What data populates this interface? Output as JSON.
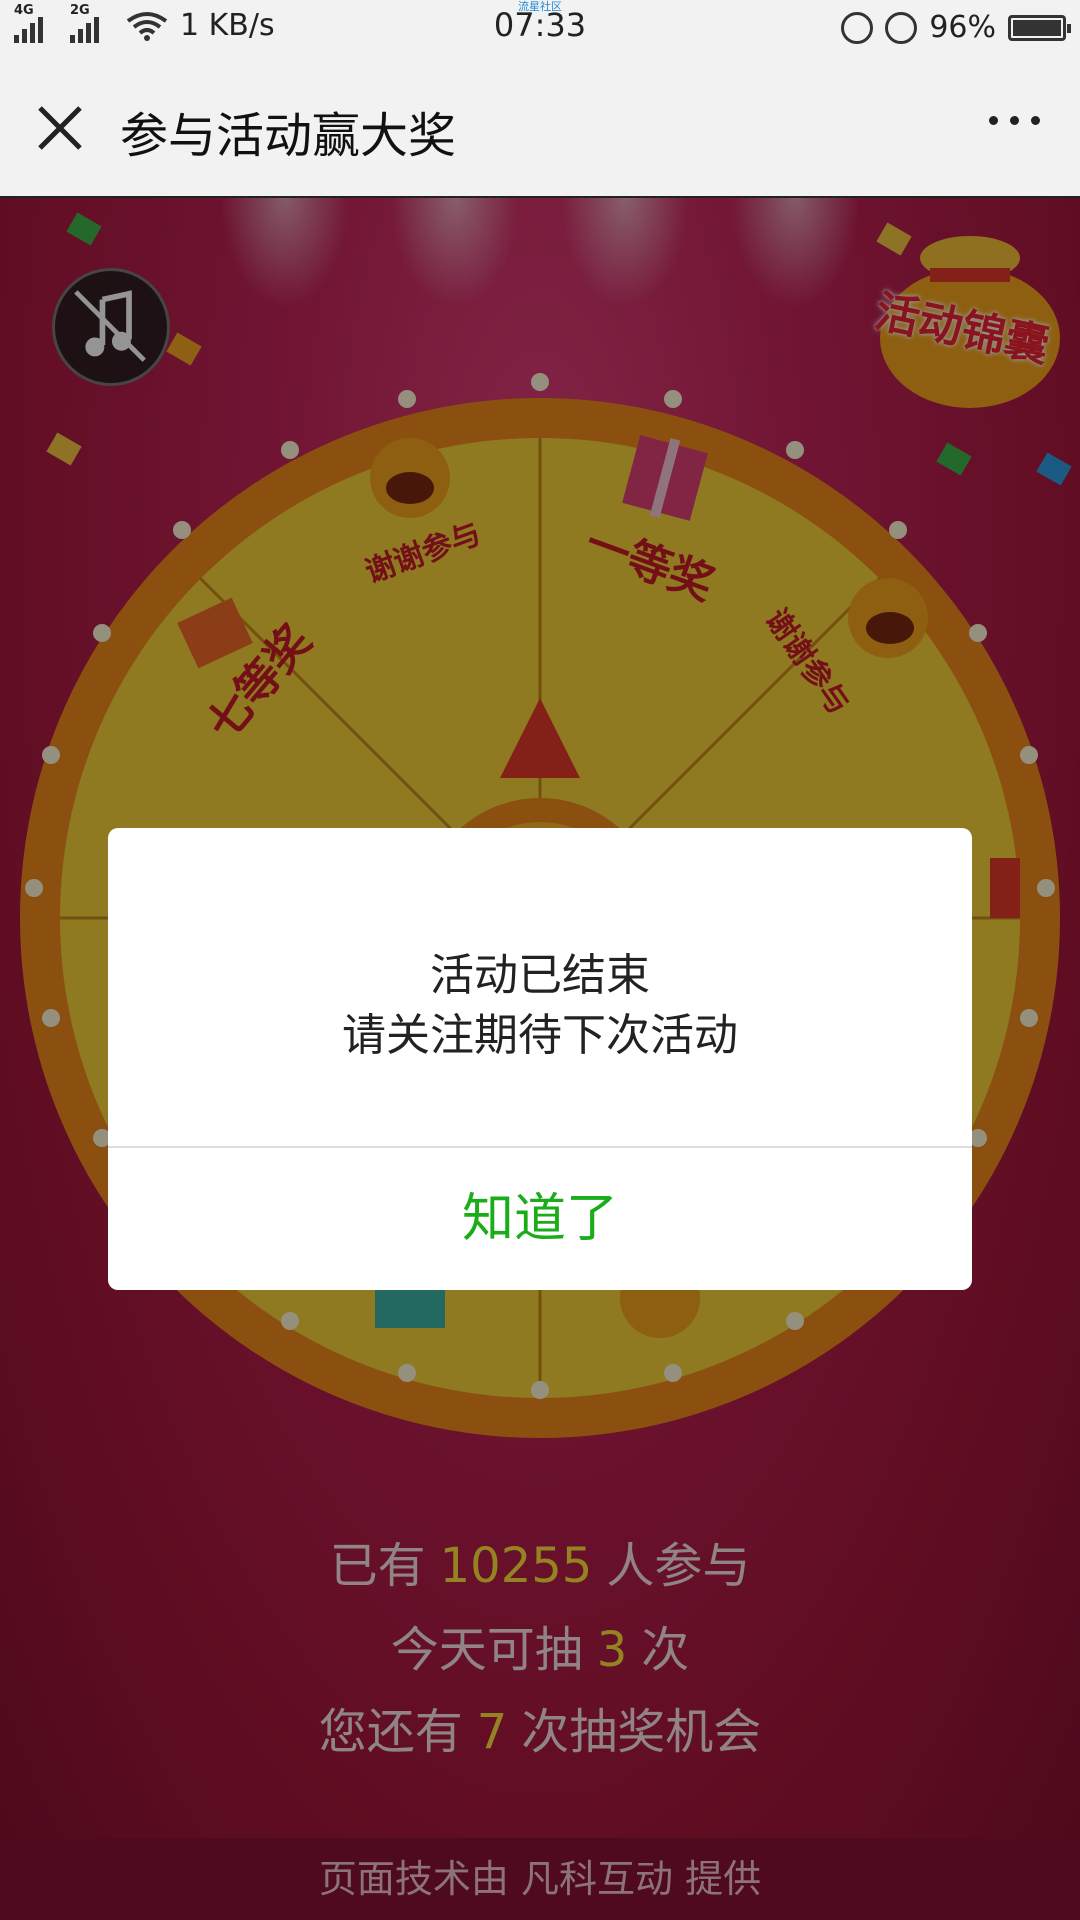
{
  "status_bar": {
    "network1": "4G",
    "network2": "2G",
    "speed": "1 KB/s",
    "time": "07:33",
    "watermark": "流星社区",
    "battery": "96%",
    "battery_level": 0.96
  },
  "header": {
    "title": "参与活动赢大奖",
    "icons": [
      "close-icon",
      "more-icon"
    ]
  },
  "main": {
    "bag_label": "活动锦囊",
    "wheel_slots": [
      "谢谢参与",
      "一等奖",
      "谢谢参与",
      "七等奖"
    ],
    "stats": {
      "participants_prefix": "已有",
      "participants": "10255",
      "participants_suffix": "人参与",
      "today_prefix": "今天可抽",
      "today": "3",
      "today_suffix": "次",
      "remaining_prefix": "您还有",
      "remaining": "7",
      "remaining_suffix": "次抽奖机会"
    },
    "footer": "页面技术由 凡科互动 提供"
  },
  "dialog": {
    "line1": "活动已结束",
    "line2": "请关注期待下次活动",
    "ok_label": "知道了"
  },
  "colors": {
    "accent_green": "#1aad19",
    "stat_number": "#ffe23a",
    "background": "#c3245a",
    "wheel_yellow": "#f6d23a",
    "wheel_orange": "#f08a1c"
  }
}
